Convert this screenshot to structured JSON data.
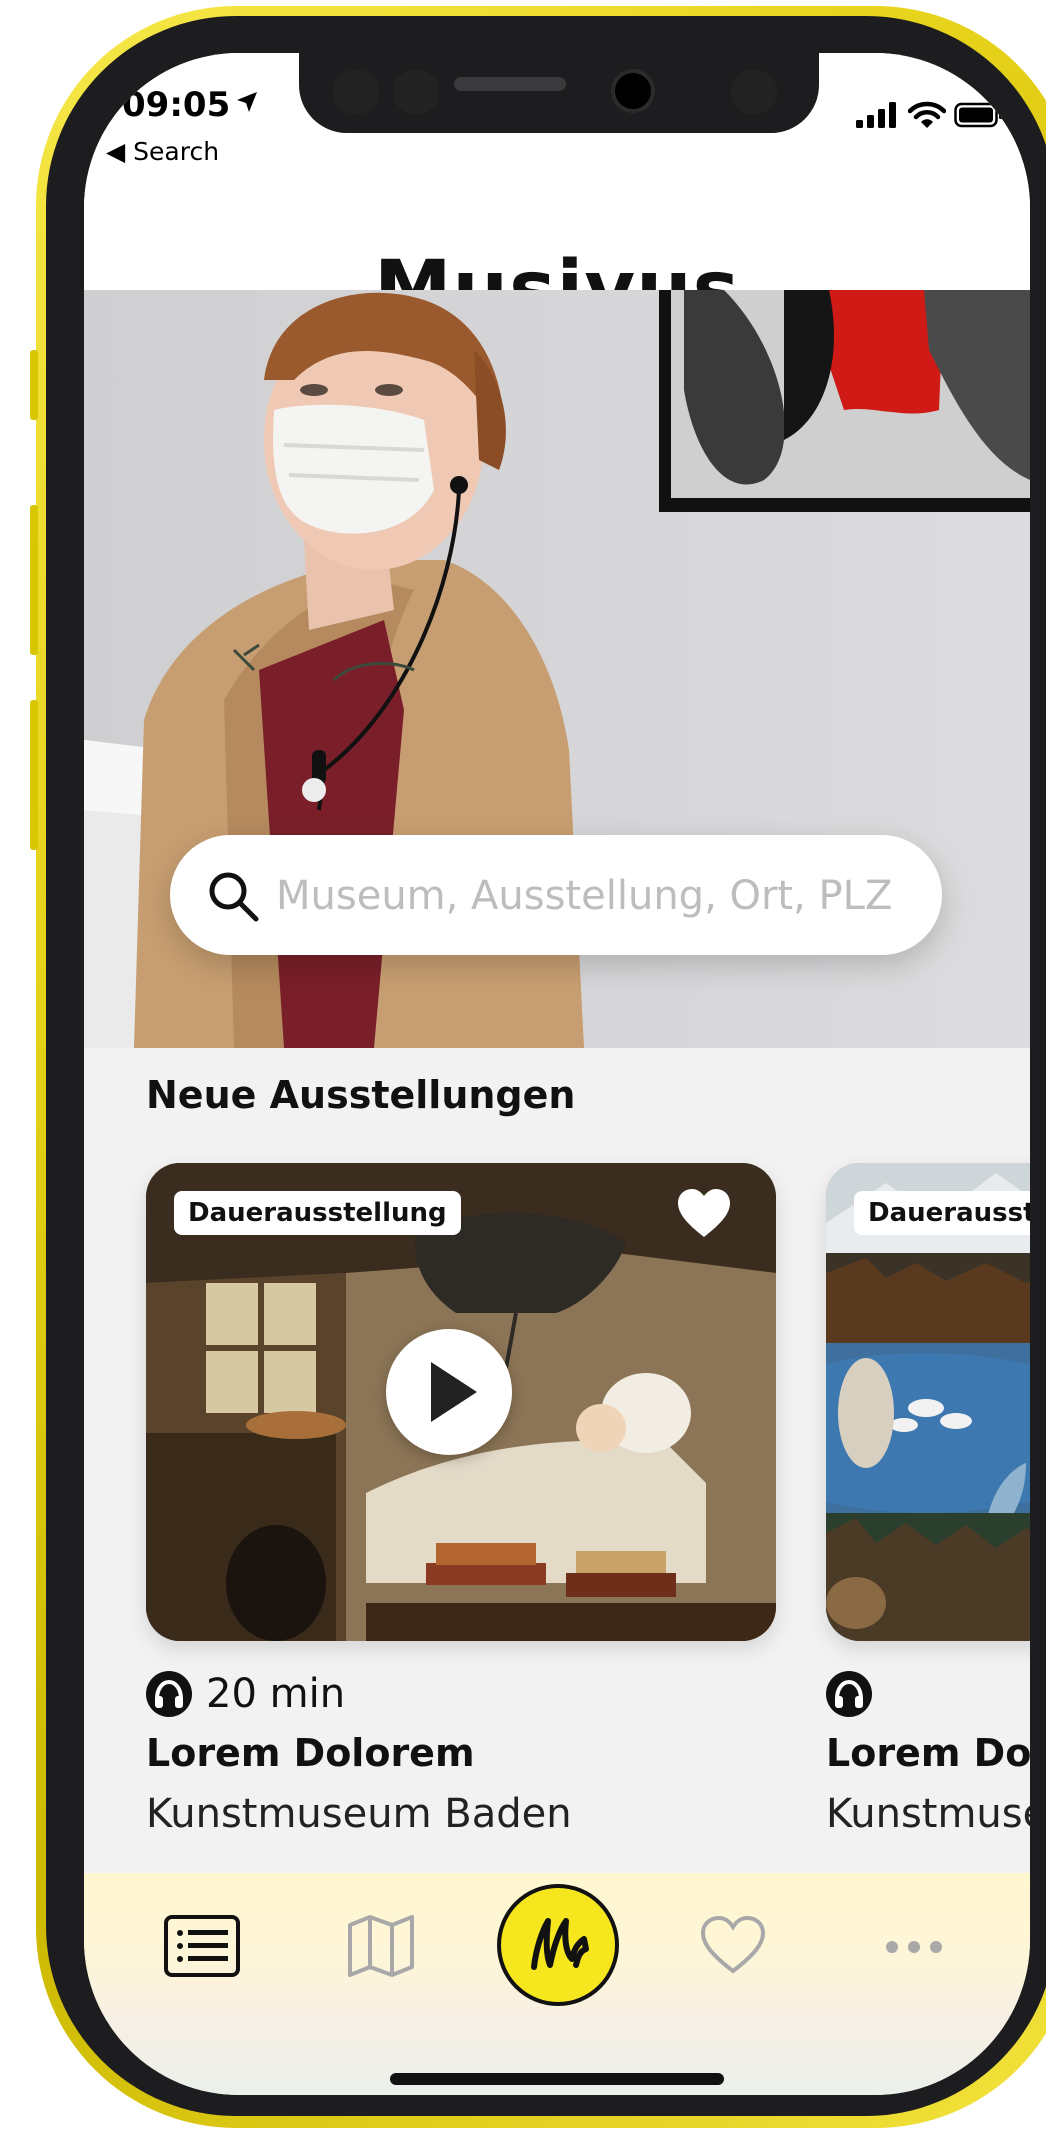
{
  "status_bar": {
    "time": "09:05",
    "back_label": "◀ Search"
  },
  "header": {
    "title": "Musivus"
  },
  "search": {
    "placeholder": "Museum, Ausstellung, Ort, PLZ"
  },
  "section": {
    "title": "Neue Ausstellungen"
  },
  "cards": [
    {
      "tag": "Dauerausstellung",
      "duration": "20 min",
      "title": "Lorem Dolorem",
      "venue": "Kunstmuseum Baden",
      "favorited": true
    },
    {
      "tag": "Dauerausstellung",
      "duration": "",
      "title": "Lorem Dolorem",
      "venue": "Kunstmuseum Baden",
      "favorited": false
    }
  ],
  "tabbar": {
    "tabs": [
      {
        "icon": "list-icon",
        "active": true
      },
      {
        "icon": "map-icon",
        "active": false
      },
      {
        "icon": "musivus-logo-icon",
        "active": false
      },
      {
        "icon": "heart-icon",
        "active": false
      },
      {
        "icon": "more-icon",
        "active": false
      }
    ]
  },
  "colors": {
    "brand_yellow": "#f5e61e",
    "text_dark": "#111111",
    "inactive_icon": "#a8a8a8"
  }
}
